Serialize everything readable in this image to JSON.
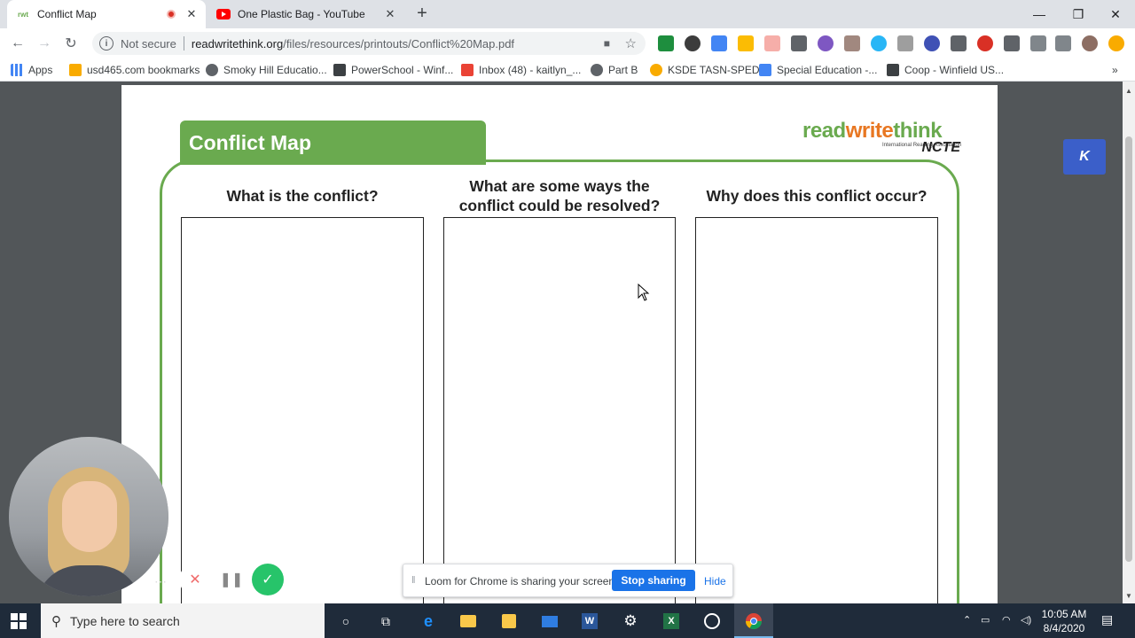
{
  "browser": {
    "tabs": [
      {
        "title": "Conflict Map",
        "favicon_text": "rwt",
        "recording": true
      },
      {
        "title": "One Plastic Bag - YouTube",
        "favicon": "youtube-icon"
      }
    ],
    "omnibox": {
      "security": "Not secure",
      "url_host": "readwritethink.org",
      "url_path": "/files/resources/printouts/Conflict%20Map.pdf"
    },
    "bookmarks": [
      {
        "label": "Apps",
        "icon": "apps-grid-icon"
      },
      {
        "label": "usd465.com bookmarks",
        "icon": "folder-icon"
      },
      {
        "label": "Smoky Hill Educatio...",
        "icon": "globe-icon"
      },
      {
        "label": "PowerSchool - Winf...",
        "icon": "powerschool-icon"
      },
      {
        "label": "Inbox (48) - kaitlyn_...",
        "icon": "gmail-icon"
      },
      {
        "label": "Part B",
        "icon": "globe-icon"
      },
      {
        "label": "KSDE TASN-SPED",
        "icon": "ksde-icon"
      },
      {
        "label": "Special Education -...",
        "icon": "doc-icon"
      },
      {
        "label": "Coop - Winfield US...",
        "icon": "coop-icon"
      }
    ]
  },
  "pdf": {
    "header_tab": "Conflict Map",
    "logo": {
      "part1": "read",
      "part2": "write",
      "part3": "think",
      "org": "NCTE",
      "ira": "International Reading Association"
    },
    "columns": [
      {
        "heading": "What is the conflict?"
      },
      {
        "heading_line1": "What are some ways the",
        "heading_line2": "conflict could be resolved?"
      },
      {
        "heading": "Why does this conflict occur?"
      }
    ]
  },
  "extension_badge": "K",
  "sharing_bar": {
    "message": "Loom for Chrome is sharing your screen.",
    "stop_label": "Stop sharing",
    "hide_label": "Hide"
  },
  "taskbar": {
    "search_placeholder": "Type here to search",
    "time": "10:05 AM",
    "date": "8/4/2020"
  }
}
